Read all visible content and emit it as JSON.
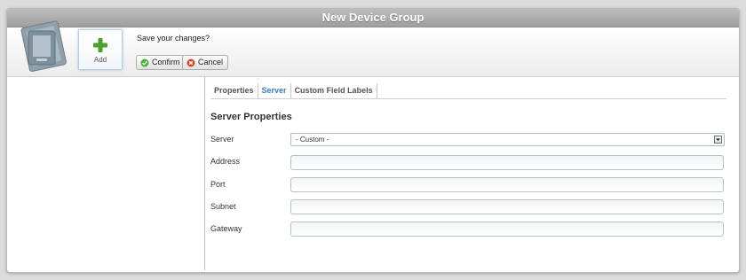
{
  "window": {
    "title": "New Device Group"
  },
  "toolbar": {
    "add_label": "Add",
    "prompt": "Save your changes?",
    "confirm_label": "Confirm",
    "cancel_label": "Cancel"
  },
  "tabs": [
    {
      "label": "Properties",
      "active": false
    },
    {
      "label": "Server",
      "active": true
    },
    {
      "label": "Custom Field Labels",
      "active": false
    }
  ],
  "server_section": {
    "title": "Server Properties",
    "fields": [
      {
        "label": "Server",
        "value": "- Custom -"
      },
      {
        "label": "Address",
        "value": ""
      },
      {
        "label": "Port",
        "value": ""
      },
      {
        "label": "Subnet",
        "value": ""
      },
      {
        "label": "Gateway",
        "value": ""
      }
    ]
  },
  "colors": {
    "title_bar": "#a9a9a9",
    "active_tab": "#3a7fc0",
    "confirm_icon": "#4caf3a",
    "cancel_icon": "#d04a2a",
    "add_icon": "#4f9f2e"
  }
}
